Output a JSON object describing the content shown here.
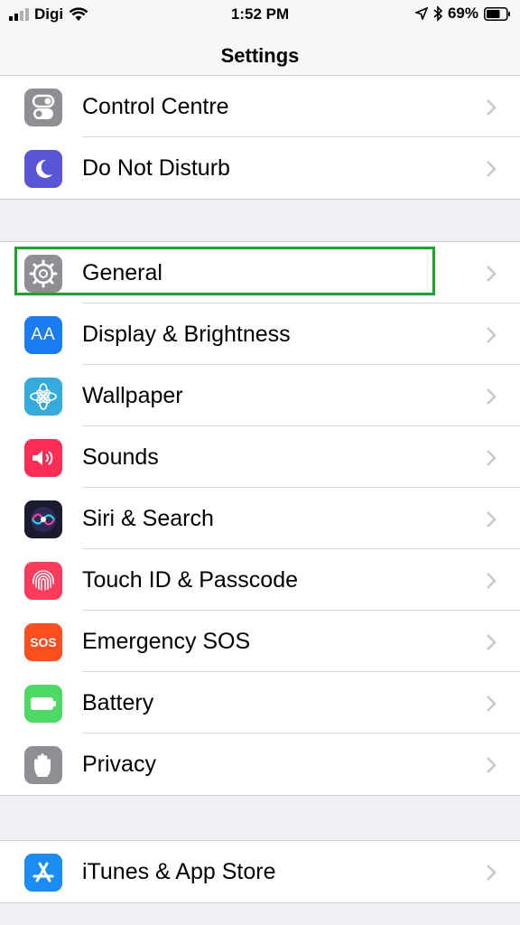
{
  "status_bar": {
    "carrier": "Digi",
    "time": "1:52 PM",
    "battery_percent": "69%",
    "battery_level": 0.69,
    "icons": [
      "signal-bars-icon",
      "wifi-icon",
      "location-arrow-icon",
      "bluetooth-icon",
      "battery-icon"
    ]
  },
  "nav": {
    "title": "Settings"
  },
  "groups": [
    {
      "items": [
        {
          "name": "control-centre",
          "label": "Control Centre",
          "icon": "switches-icon",
          "color": "#8e8e93"
        },
        {
          "name": "do-not-disturb",
          "label": "Do Not Disturb",
          "icon": "moon-icon",
          "color": "#5856d6"
        }
      ]
    },
    {
      "items": [
        {
          "name": "general",
          "label": "General",
          "icon": "gear-icon",
          "color": "#8e8e93"
        },
        {
          "name": "display-brightness",
          "label": "Display & Brightness",
          "icon": "text-size-icon",
          "icon_text": "AA",
          "color": "#1a7cf5"
        },
        {
          "name": "wallpaper",
          "label": "Wallpaper",
          "icon": "flower-icon",
          "color": "#35aadc"
        },
        {
          "name": "sounds",
          "label": "Sounds",
          "icon": "speaker-icon",
          "color": "#ff2d55"
        },
        {
          "name": "siri-search",
          "label": "Siri & Search",
          "icon": "siri-icon",
          "color": "#1b1b2f"
        },
        {
          "name": "touch-id-passcode",
          "label": "Touch ID & Passcode",
          "icon": "fingerprint-icon",
          "color": "#ff3b5c"
        },
        {
          "name": "emergency-sos",
          "label": "Emergency SOS",
          "icon": "sos-icon",
          "icon_text": "SOS",
          "color": "#ff3b30"
        },
        {
          "name": "battery",
          "label": "Battery",
          "icon": "battery-icon",
          "color": "#4cd964"
        },
        {
          "name": "privacy",
          "label": "Privacy",
          "icon": "hand-icon",
          "color": "#8e8e93"
        }
      ]
    },
    {
      "items": [
        {
          "name": "itunes-app-store",
          "label": "iTunes & App Store",
          "icon": "app-store-icon",
          "color": "#1a8cf5"
        }
      ]
    }
  ],
  "highlight": {
    "target": "general",
    "color": "#1aa52a"
  }
}
